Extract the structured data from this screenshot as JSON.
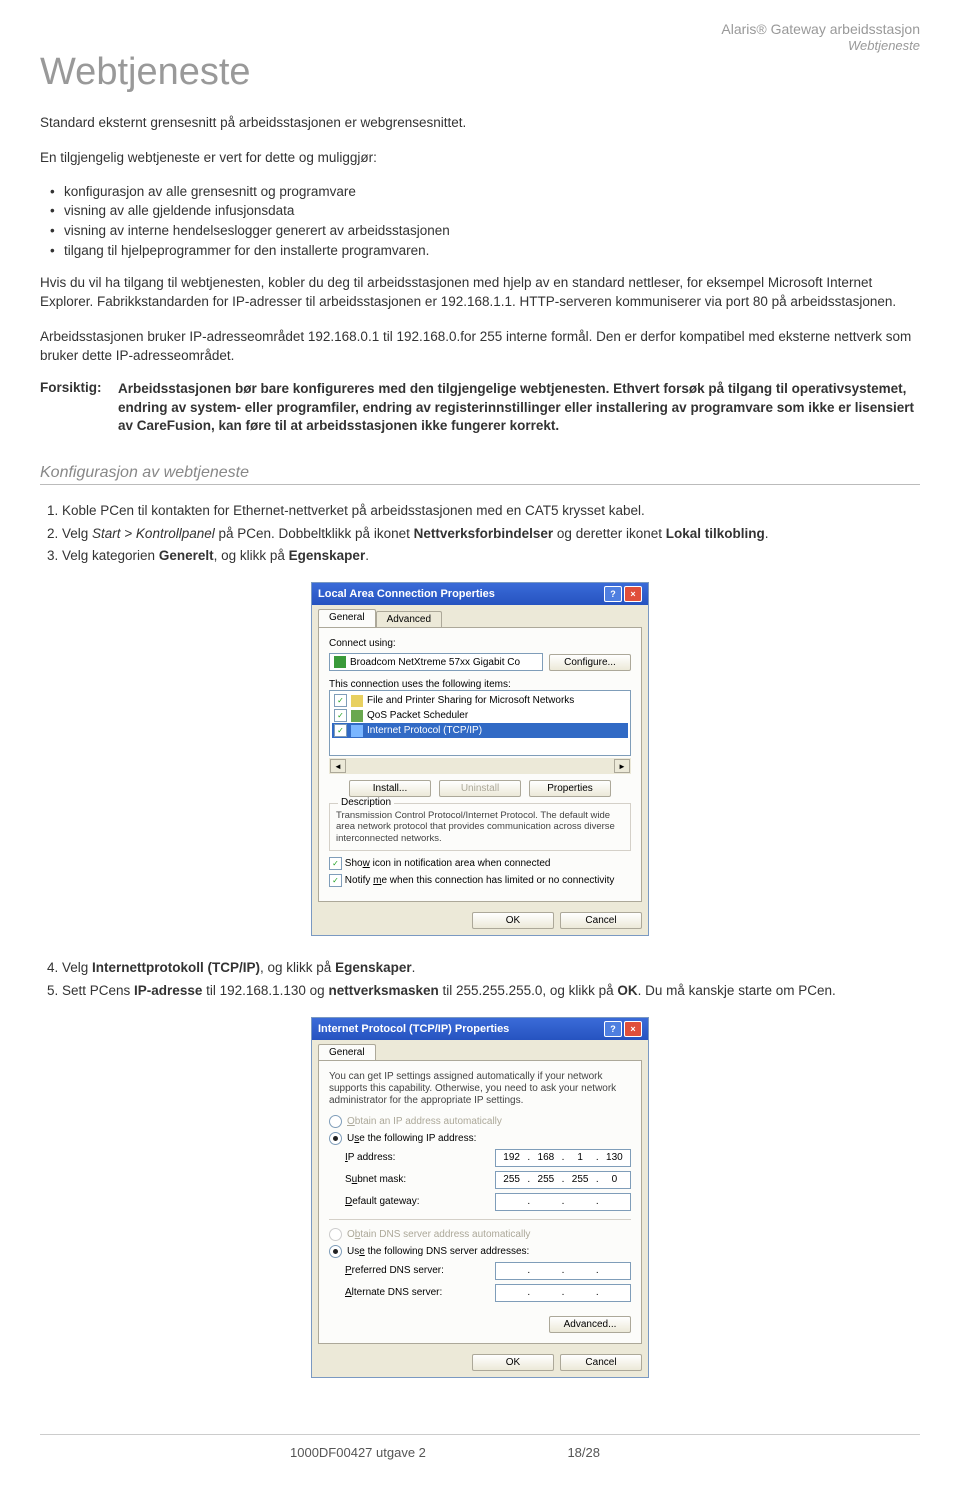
{
  "header": {
    "product": "Alaris® Gateway arbeidsstasjon",
    "section": "Webtjeneste"
  },
  "title": "Webtjeneste",
  "p_intro": "Standard eksternt grensesnitt på arbeidsstasjonen er webgrensesnittet.",
  "p_lead": "En tilgjengelig webtjeneste er vert for dette og muliggjør:",
  "bullets": [
    "konfigurasjon av alle grensesnitt og programvare",
    "visning av alle gjeldende infusjonsdata",
    "visning av interne hendelseslogger generert av arbeidsstasjonen",
    "tilgang til hjelpeprogrammer for den installerte programvaren."
  ],
  "p_after": "Hvis du vil ha tilgang til webtjenesten, kobler du deg til arbeidsstasjonen med hjelp av en standard nettleser, for eksempel Microsoft Internet Explorer. Fabrikkstandarden for IP-adresser til arbeidsstasjonen er 192.168.1.1. HTTP-serveren kommuniserer via port 80 på arbeidsstasjonen.",
  "p_range": "Arbeidsstasjonen bruker IP-adresseområdet 192.168.0.1 til 192.168.0.for 255 interne formål. Den er derfor kompatibel med eksterne nettverk som bruker dette IP-adresseområdet.",
  "caution": {
    "label": "Forsiktig:",
    "text": "Arbeidsstasjonen bør bare konfigureres med den tilgjengelige webtjenesten. Ethvert forsøk på tilgang til operativsystemet, endring av system- eller programfiler, endring av registerinnstillinger eller installering av programvare som ikke er lisensiert av CareFusion, kan føre til at arbeidsstasjonen ikke fungerer korrekt."
  },
  "subheading": "Konfigurasjon av webtjeneste",
  "steps1": [
    "Koble PCen til kontakten for Ethernet-nettverket på arbeidsstasjonen med en CAT5 krysset kabel.",
    "Velg <span class='i'>Start &gt; Kontrollpanel</span> på PCen. Dobbeltklikk på ikonet <span class='b'>Nettverksforbindelser</span> og deretter ikonet <span class='b'>Lokal tilkobling</span>.",
    "Velg kategorien <span class='b'>Generelt</span>, og klikk på <span class='b'>Egenskaper</span>."
  ],
  "dlg1": {
    "title": "Local Area Connection Properties",
    "tabs": [
      "General",
      "Advanced"
    ],
    "connect_using": "Connect using:",
    "adapter": "Broadcom NetXtreme 57xx Gigabit Co",
    "configure": "Configure...",
    "items_label": "This connection uses the following items:",
    "items": [
      {
        "chk": true,
        "name": "File and Printer Sharing for Microsoft Networks"
      },
      {
        "chk": true,
        "name": "QoS Packet Scheduler"
      },
      {
        "chk": true,
        "name": "Internet Protocol (TCP/IP)",
        "sel": true
      }
    ],
    "install": "Install...",
    "uninstall": "Uninstall",
    "properties": "Properties",
    "desc_group": "Description",
    "desc": "Transmission Control Protocol/Internet Protocol. The default wide area network protocol that provides communication across diverse interconnected networks.",
    "chk1": "Show icon in notification area when connected",
    "chk2": "Notify me when this connection has limited or no connectivity",
    "ok": "OK",
    "cancel": "Cancel"
  },
  "steps2": [
    "Velg <span class='b'>Internettprotokoll (TCP/IP)</span>, og klikk på <span class='b'>Egenskaper</span>.",
    "Sett PCens <span class='b'>IP-adresse</span> til 192.168.1.130 og <span class='b'>nettverksmasken</span> til 255.255.255.0, og klikk på <span class='b'>OK</span>. Du må kanskje starte om PCen."
  ],
  "dlg2": {
    "title": "Internet Protocol (TCP/IP) Properties",
    "tab": "General",
    "intro": "You can get IP settings assigned automatically if your network supports this capability. Otherwise, you need to ask your network administrator for the appropriate IP settings.",
    "r1": "Obtain an IP address automatically",
    "r2": "Use the following IP address:",
    "ip_label": "IP address:",
    "ip": [
      "192",
      "168",
      "1",
      "130"
    ],
    "sm_label": "Subnet mask:",
    "sm": [
      "255",
      "255",
      "255",
      "0"
    ],
    "gw_label": "Default gateway:",
    "gw": [
      "",
      "",
      "",
      ""
    ],
    "r3": "Obtain DNS server address automatically",
    "r4": "Use the following DNS server addresses:",
    "dns1_label": "Preferred DNS server:",
    "dns1": [
      "",
      "",
      "",
      ""
    ],
    "dns2_label": "Alternate DNS server:",
    "dns2": [
      "",
      "",
      "",
      ""
    ],
    "advanced": "Advanced...",
    "ok": "OK",
    "cancel": "Cancel"
  },
  "footer": {
    "left": "1000DF00427 utgave 2",
    "right": "18/28"
  }
}
